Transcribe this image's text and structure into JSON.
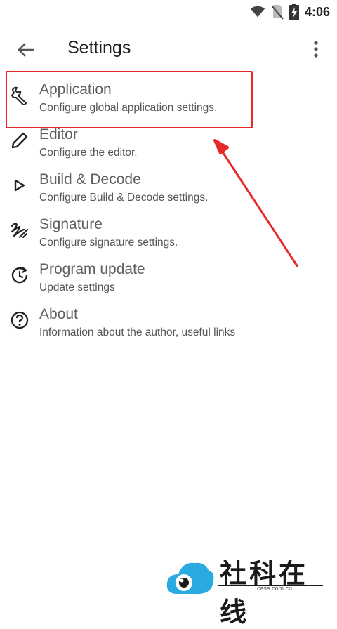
{
  "status_bar": {
    "time": "4:06"
  },
  "app_bar": {
    "title": "Settings"
  },
  "settings_items": [
    {
      "label": "Application",
      "sub": "Configure global application settings.",
      "icon": "wrench-icon"
    },
    {
      "label": "Editor",
      "sub": "Configure the editor.",
      "icon": "pencil-icon"
    },
    {
      "label": "Build & Decode",
      "sub": "Configure Build & Decode settings.",
      "icon": "play-icon"
    },
    {
      "label": "Signature",
      "sub": "Configure signature settings.",
      "icon": "signature-icon"
    },
    {
      "label": "Program update",
      "sub": "Update settings",
      "icon": "update-icon"
    },
    {
      "label": "About",
      "sub": "Information about the author, useful links",
      "icon": "help-icon"
    }
  ],
  "watermark": {
    "text": "社科在线",
    "sub": "cass.com.cn"
  },
  "colors": {
    "highlight": "#e8292a",
    "text": "#212121",
    "secondary": "#555555"
  }
}
